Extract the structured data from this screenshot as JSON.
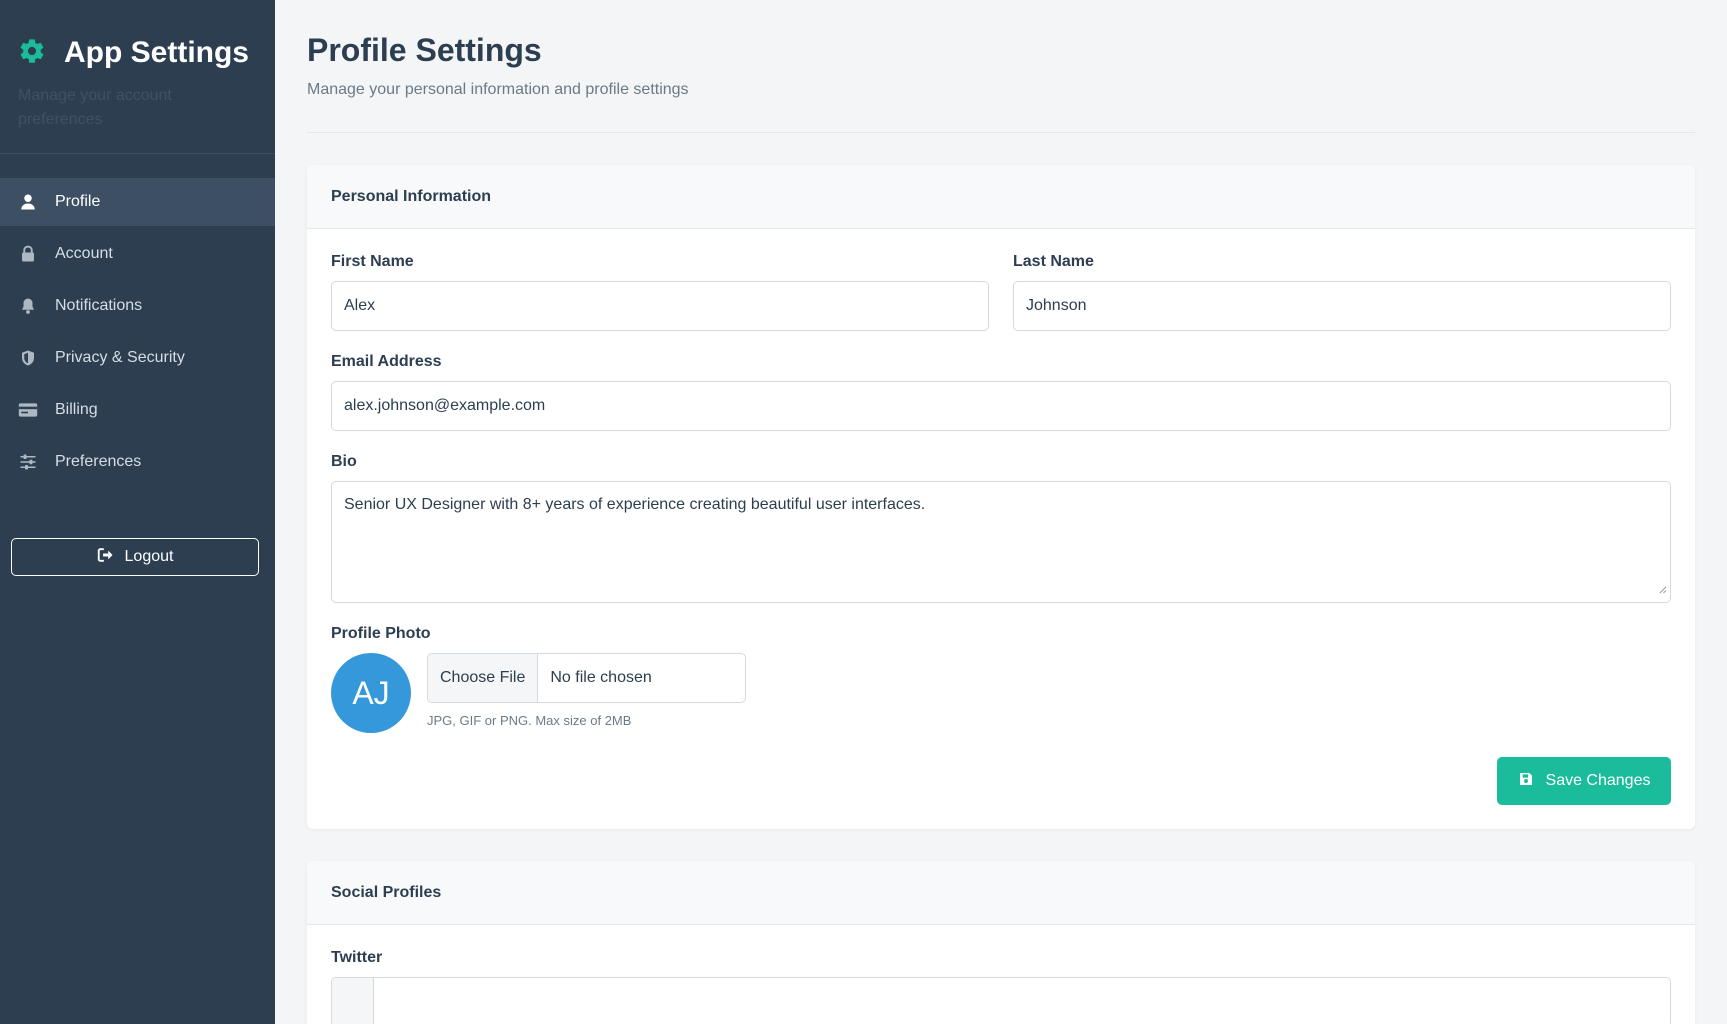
{
  "sidebar": {
    "brand_title": "App Settings",
    "brand_subtitle": "Manage your account preferences",
    "items": [
      {
        "label": "Profile",
        "icon": "user-icon"
      },
      {
        "label": "Account",
        "icon": "lock-icon"
      },
      {
        "label": "Notifications",
        "icon": "bell-icon"
      },
      {
        "label": "Privacy & Security",
        "icon": "shield-icon"
      },
      {
        "label": "Billing",
        "icon": "credit-card-icon"
      },
      {
        "label": "Preferences",
        "icon": "sliders-icon"
      }
    ],
    "active_item": "Profile",
    "logout_label": "Logout"
  },
  "header": {
    "title": "Profile Settings",
    "subtitle": "Manage your personal information and profile settings"
  },
  "personal": {
    "section_title": "Personal Information",
    "first_name_label": "First Name",
    "first_name_value": "Alex",
    "last_name_label": "Last Name",
    "last_name_value": "Johnson",
    "email_label": "Email Address",
    "email_value": "alex.johnson@example.com",
    "bio_label": "Bio",
    "bio_value": "Senior UX Designer with 8+ years of experience creating beautiful user interfaces.",
    "photo_label": "Profile Photo",
    "avatar_initials": "AJ",
    "choose_file_label": "Choose File",
    "file_status": "No file chosen",
    "photo_hint": "JPG, GIF or PNG. Max size of 2MB",
    "save_label": "Save Changes"
  },
  "social": {
    "section_title": "Social Profiles",
    "twitter_label": "Twitter"
  },
  "colors": {
    "sidebar_bg": "#2c3e50",
    "accent": "#1abc9c",
    "avatar_bg": "#3498db"
  }
}
